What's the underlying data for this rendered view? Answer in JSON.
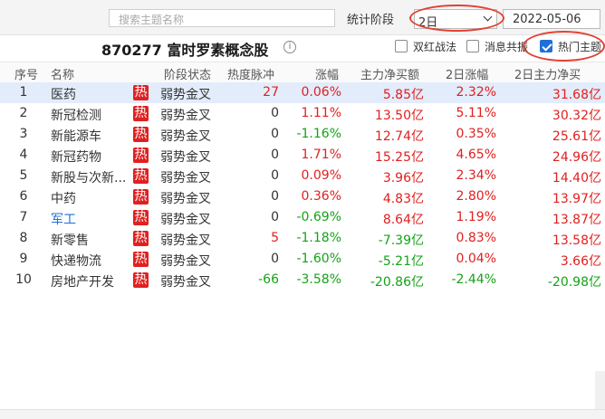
{
  "toolbar": {
    "search_placeholder": "搜索主题名称",
    "stage_label": "统计阶段",
    "stage_value": "2日",
    "date_value": "2022-05-06"
  },
  "title": {
    "text": "870277 富时罗素概念股",
    "info_icon": "info-icon"
  },
  "options": {
    "double_red": {
      "label": "双红战法",
      "checked": false
    },
    "news": {
      "label": "消息共振",
      "checked": false
    },
    "hot_topics": {
      "label": "热门主题",
      "checked": true
    }
  },
  "columns": [
    "序号",
    "名称",
    "阶段状态",
    "热度脉冲",
    "涨幅",
    "主力净买额",
    "2日涨幅",
    "2日主力净买"
  ],
  "hot_badge": "热",
  "rows": [
    {
      "idx": "1",
      "name": "医药",
      "name_color": "dark",
      "status": "弱势金叉",
      "heat": "27",
      "heat_color": "red",
      "chg": "0.06%",
      "chg_color": "red",
      "net": "5.85亿",
      "net_color": "red",
      "chg2": "2.32%",
      "chg2_color": "red",
      "net2": "31.68亿",
      "net2_color": "red"
    },
    {
      "idx": "2",
      "name": "新冠检测",
      "name_color": "dark",
      "status": "弱势金叉",
      "heat": "0",
      "heat_color": "dark",
      "chg": "1.11%",
      "chg_color": "red",
      "net": "13.50亿",
      "net_color": "red",
      "chg2": "5.11%",
      "chg2_color": "red",
      "net2": "30.32亿",
      "net2_color": "red"
    },
    {
      "idx": "3",
      "name": "新能源车",
      "name_color": "dark",
      "status": "弱势金叉",
      "heat": "0",
      "heat_color": "dark",
      "chg": "-1.16%",
      "chg_color": "green",
      "net": "12.74亿",
      "net_color": "red",
      "chg2": "0.35%",
      "chg2_color": "red",
      "net2": "25.61亿",
      "net2_color": "red"
    },
    {
      "idx": "4",
      "name": "新冠药物",
      "name_color": "dark",
      "status": "弱势金叉",
      "heat": "0",
      "heat_color": "dark",
      "chg": "1.71%",
      "chg_color": "red",
      "net": "15.25亿",
      "net_color": "red",
      "chg2": "4.65%",
      "chg2_color": "red",
      "net2": "24.96亿",
      "net2_color": "red"
    },
    {
      "idx": "5",
      "name": "新股与次新...",
      "name_color": "dark",
      "status": "弱势金叉",
      "heat": "0",
      "heat_color": "dark",
      "chg": "0.09%",
      "chg_color": "red",
      "net": "3.96亿",
      "net_color": "red",
      "chg2": "2.34%",
      "chg2_color": "red",
      "net2": "14.40亿",
      "net2_color": "red"
    },
    {
      "idx": "6",
      "name": "中药",
      "name_color": "dark",
      "status": "弱势金叉",
      "heat": "0",
      "heat_color": "dark",
      "chg": "0.36%",
      "chg_color": "red",
      "net": "4.83亿",
      "net_color": "red",
      "chg2": "2.80%",
      "chg2_color": "red",
      "net2": "13.97亿",
      "net2_color": "red"
    },
    {
      "idx": "7",
      "name": "军工",
      "name_color": "blue",
      "status": "弱势金叉",
      "heat": "0",
      "heat_color": "dark",
      "chg": "-0.69%",
      "chg_color": "green",
      "net": "8.64亿",
      "net_color": "red",
      "chg2": "1.19%",
      "chg2_color": "red",
      "net2": "13.87亿",
      "net2_color": "red"
    },
    {
      "idx": "8",
      "name": "新零售",
      "name_color": "dark",
      "status": "弱势金叉",
      "heat": "5",
      "heat_color": "red",
      "chg": "-1.18%",
      "chg_color": "green",
      "net": "-7.39亿",
      "net_color": "green",
      "chg2": "0.83%",
      "chg2_color": "red",
      "net2": "13.58亿",
      "net2_color": "red"
    },
    {
      "idx": "9",
      "name": "快递物流",
      "name_color": "dark",
      "status": "弱势金叉",
      "heat": "0",
      "heat_color": "dark",
      "chg": "-1.60%",
      "chg_color": "green",
      "net": "-5.21亿",
      "net_color": "green",
      "chg2": "0.04%",
      "chg2_color": "red",
      "net2": "3.66亿",
      "net2_color": "red"
    },
    {
      "idx": "10",
      "name": "房地产开发",
      "name_color": "dark",
      "status": "弱势金叉",
      "heat": "-66",
      "heat_color": "green",
      "chg": "-3.58%",
      "chg_color": "green",
      "net": "-20.86亿",
      "net_color": "green",
      "chg2": "-2.44%",
      "chg2_color": "green",
      "net2": "-20.98亿",
      "net2_color": "green"
    }
  ],
  "colors": {
    "up": "#e02020",
    "down": "#14a316",
    "highlight_ring": "#e24133",
    "selected_row": "#e3ecfb",
    "checkbox": "#1e6fd9"
  }
}
